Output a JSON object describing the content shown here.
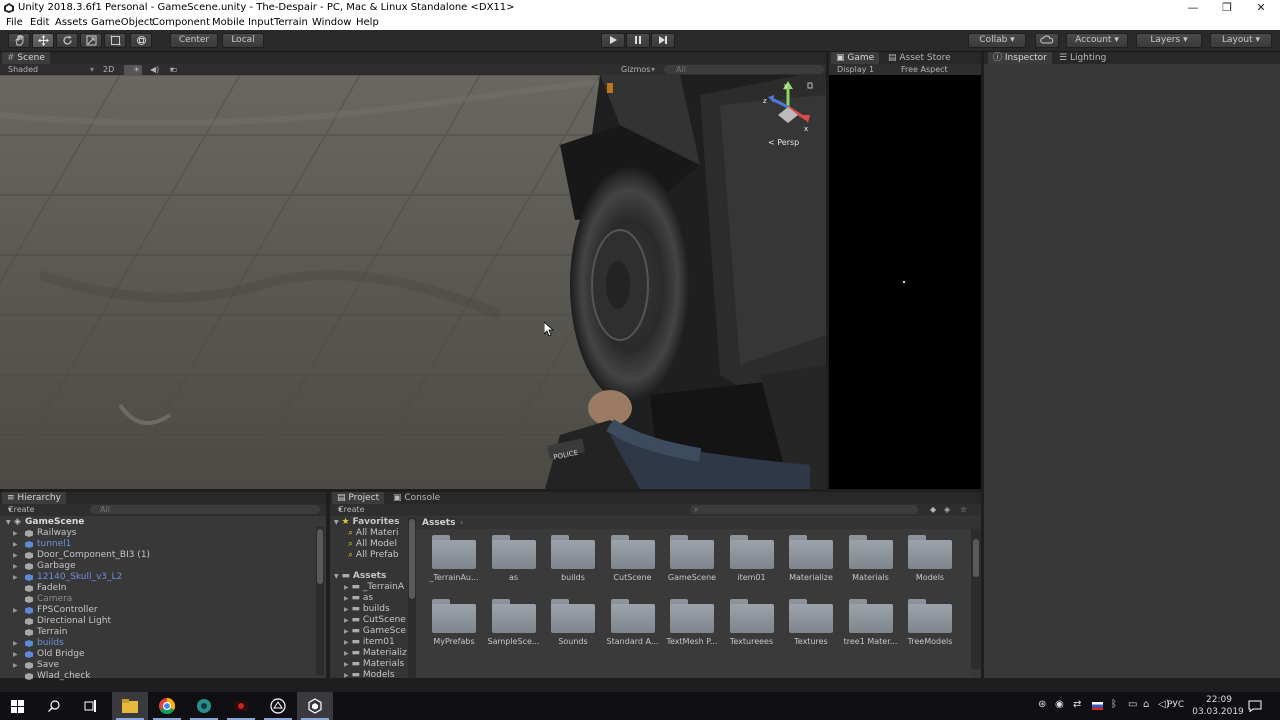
{
  "window": {
    "title": "Unity 2018.3.6f1 Personal - GameScene.unity - The-Despair - PC, Mac & Linux Standalone <DX11>",
    "minimize": "—",
    "maximize": "❐",
    "close": "✕"
  },
  "menu": [
    "File",
    "Edit",
    "Assets",
    "GameObject",
    "Component",
    "Mobile Input",
    "Terrain",
    "Window",
    "Help"
  ],
  "toolbar": {
    "pivot": "Center",
    "space": "Local",
    "collab": "Collab ▾",
    "account": "Account",
    "layers": "Layers",
    "layout": "Layout"
  },
  "scene": {
    "tab": "Scene",
    "shading": "Shaded",
    "mode_2d": "2D",
    "gizmos": "Gizmos",
    "search_placeholder": "All",
    "projection": "< Persp"
  },
  "game": {
    "tab_game": "Game",
    "tab_store": "Asset Store",
    "display": "Display 1",
    "aspect": "Free Aspect"
  },
  "inspector": {
    "tab": "Inspector",
    "tab_lighting": "Lighting"
  },
  "hierarchy": {
    "tab": "Hierarchy",
    "create": "Create",
    "search_placeholder": "All",
    "scene_name": "GameScene",
    "items": [
      {
        "label": "Railways",
        "color": "normal",
        "arrow": "▶",
        "icon": "cube-icon"
      },
      {
        "label": "tunnel1",
        "color": "blue",
        "arrow": "▶",
        "icon": "prefab-icon"
      },
      {
        "label": "Door_Component_BI3 (1)",
        "color": "normal",
        "arrow": "▶",
        "icon": "cube-icon"
      },
      {
        "label": "Garbage",
        "color": "normal",
        "arrow": "▶",
        "icon": "cube-icon"
      },
      {
        "label": "12140_Skull_v3_L2",
        "color": "blue",
        "arrow": "▶",
        "icon": "prefab-icon"
      },
      {
        "label": "FadeIn",
        "color": "normal",
        "arrow": "",
        "icon": "cube-icon"
      },
      {
        "label": "Camera",
        "color": "grey",
        "arrow": "",
        "icon": "cube-icon"
      },
      {
        "label": "FPSController",
        "color": "normal",
        "arrow": "▶",
        "icon": "prefab-icon"
      },
      {
        "label": "Directional Light",
        "color": "normal",
        "arrow": "",
        "icon": "cube-icon"
      },
      {
        "label": "Terrain",
        "color": "normal",
        "arrow": "",
        "icon": "cube-icon"
      },
      {
        "label": "builds",
        "color": "blue",
        "arrow": "▶",
        "icon": "prefab-icon"
      },
      {
        "label": "Old Bridge",
        "color": "normal",
        "arrow": "▶",
        "icon": "prefab-icon"
      },
      {
        "label": "Save",
        "color": "normal",
        "arrow": "▶",
        "icon": "cube-icon"
      },
      {
        "label": "Wlad_check",
        "color": "normal",
        "arrow": "",
        "icon": "cube-icon"
      }
    ]
  },
  "project": {
    "tab": "Project",
    "tab_console": "Console",
    "create": "Create",
    "breadcrumb": "Assets",
    "favorites_label": "Favorites",
    "favorites": [
      "All Materi",
      "All Model",
      "All Prefab"
    ],
    "assets_label": "Assets",
    "tree": [
      "_TerrainA",
      "as",
      "builds",
      "CutScene",
      "GameSce",
      "item01",
      "Materializ",
      "Materials",
      "Models"
    ],
    "folders_row1": [
      "_TerrainAu...",
      "as",
      "builds",
      "CutScene",
      "GameScene",
      "item01",
      "Materialize",
      "Materials",
      "Models"
    ],
    "folders_row2": [
      "MyPrefabs",
      "SampleSce...",
      "Sounds",
      "Standard A...",
      "TextMesh P...",
      "Textureees",
      "Textures",
      "tree1 Mater...",
      "TreeModels"
    ]
  },
  "taskbar": {
    "language": "РУС",
    "time": "22:09",
    "date": "03.03.2019"
  }
}
